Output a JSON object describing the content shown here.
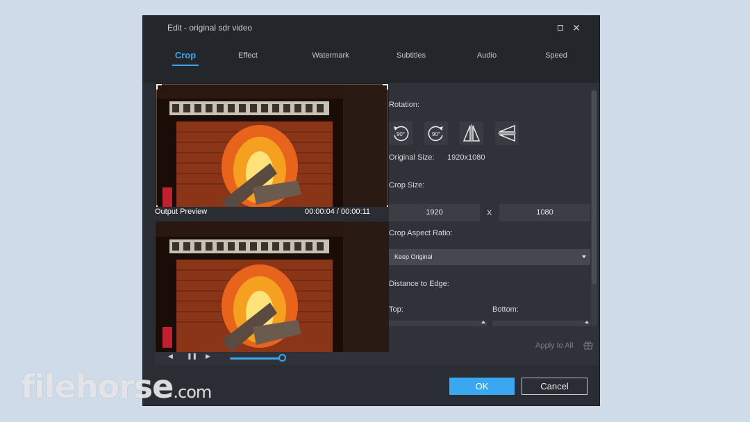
{
  "window": {
    "title": "Edit - original sdr video",
    "maximize_icon": "maximize-icon",
    "close_icon": "close-icon"
  },
  "tabs": [
    {
      "label": "Crop",
      "active": true
    },
    {
      "label": "Effect",
      "active": false
    },
    {
      "label": "Watermark",
      "active": false
    },
    {
      "label": "Subtitles",
      "active": false
    },
    {
      "label": "Audio",
      "active": false
    },
    {
      "label": "Speed",
      "active": false
    }
  ],
  "preview": {
    "output_label": "Output Preview",
    "timecode": "00:00:04 / 00:00:11",
    "progress": 0.36
  },
  "settings": {
    "rotation_label": "Rotation:",
    "rotate_cw_text": "90°",
    "rotate_ccw_text": "90°",
    "original_size_label": "Original Size:",
    "original_size_value": "1920x1080",
    "crop_size_label": "Crop Size:",
    "crop_width": "1920",
    "crop_separator": "X",
    "crop_height": "1080",
    "aspect_ratio_label": "Crop Aspect Ratio:",
    "aspect_ratio_value": "Keep Original",
    "distance_label": "Distance to Edge:",
    "top_label": "Top:",
    "bottom_label": "Bottom:"
  },
  "apply_all": "Apply to All",
  "buttons": {
    "ok": "OK",
    "cancel": "Cancel"
  },
  "watermark": {
    "brand": "filehorse",
    "suffix": ".com"
  },
  "colors": {
    "accent": "#3aa8f0",
    "dialog_bg": "#2a2d33",
    "backdrop": "#cfdbe8"
  }
}
